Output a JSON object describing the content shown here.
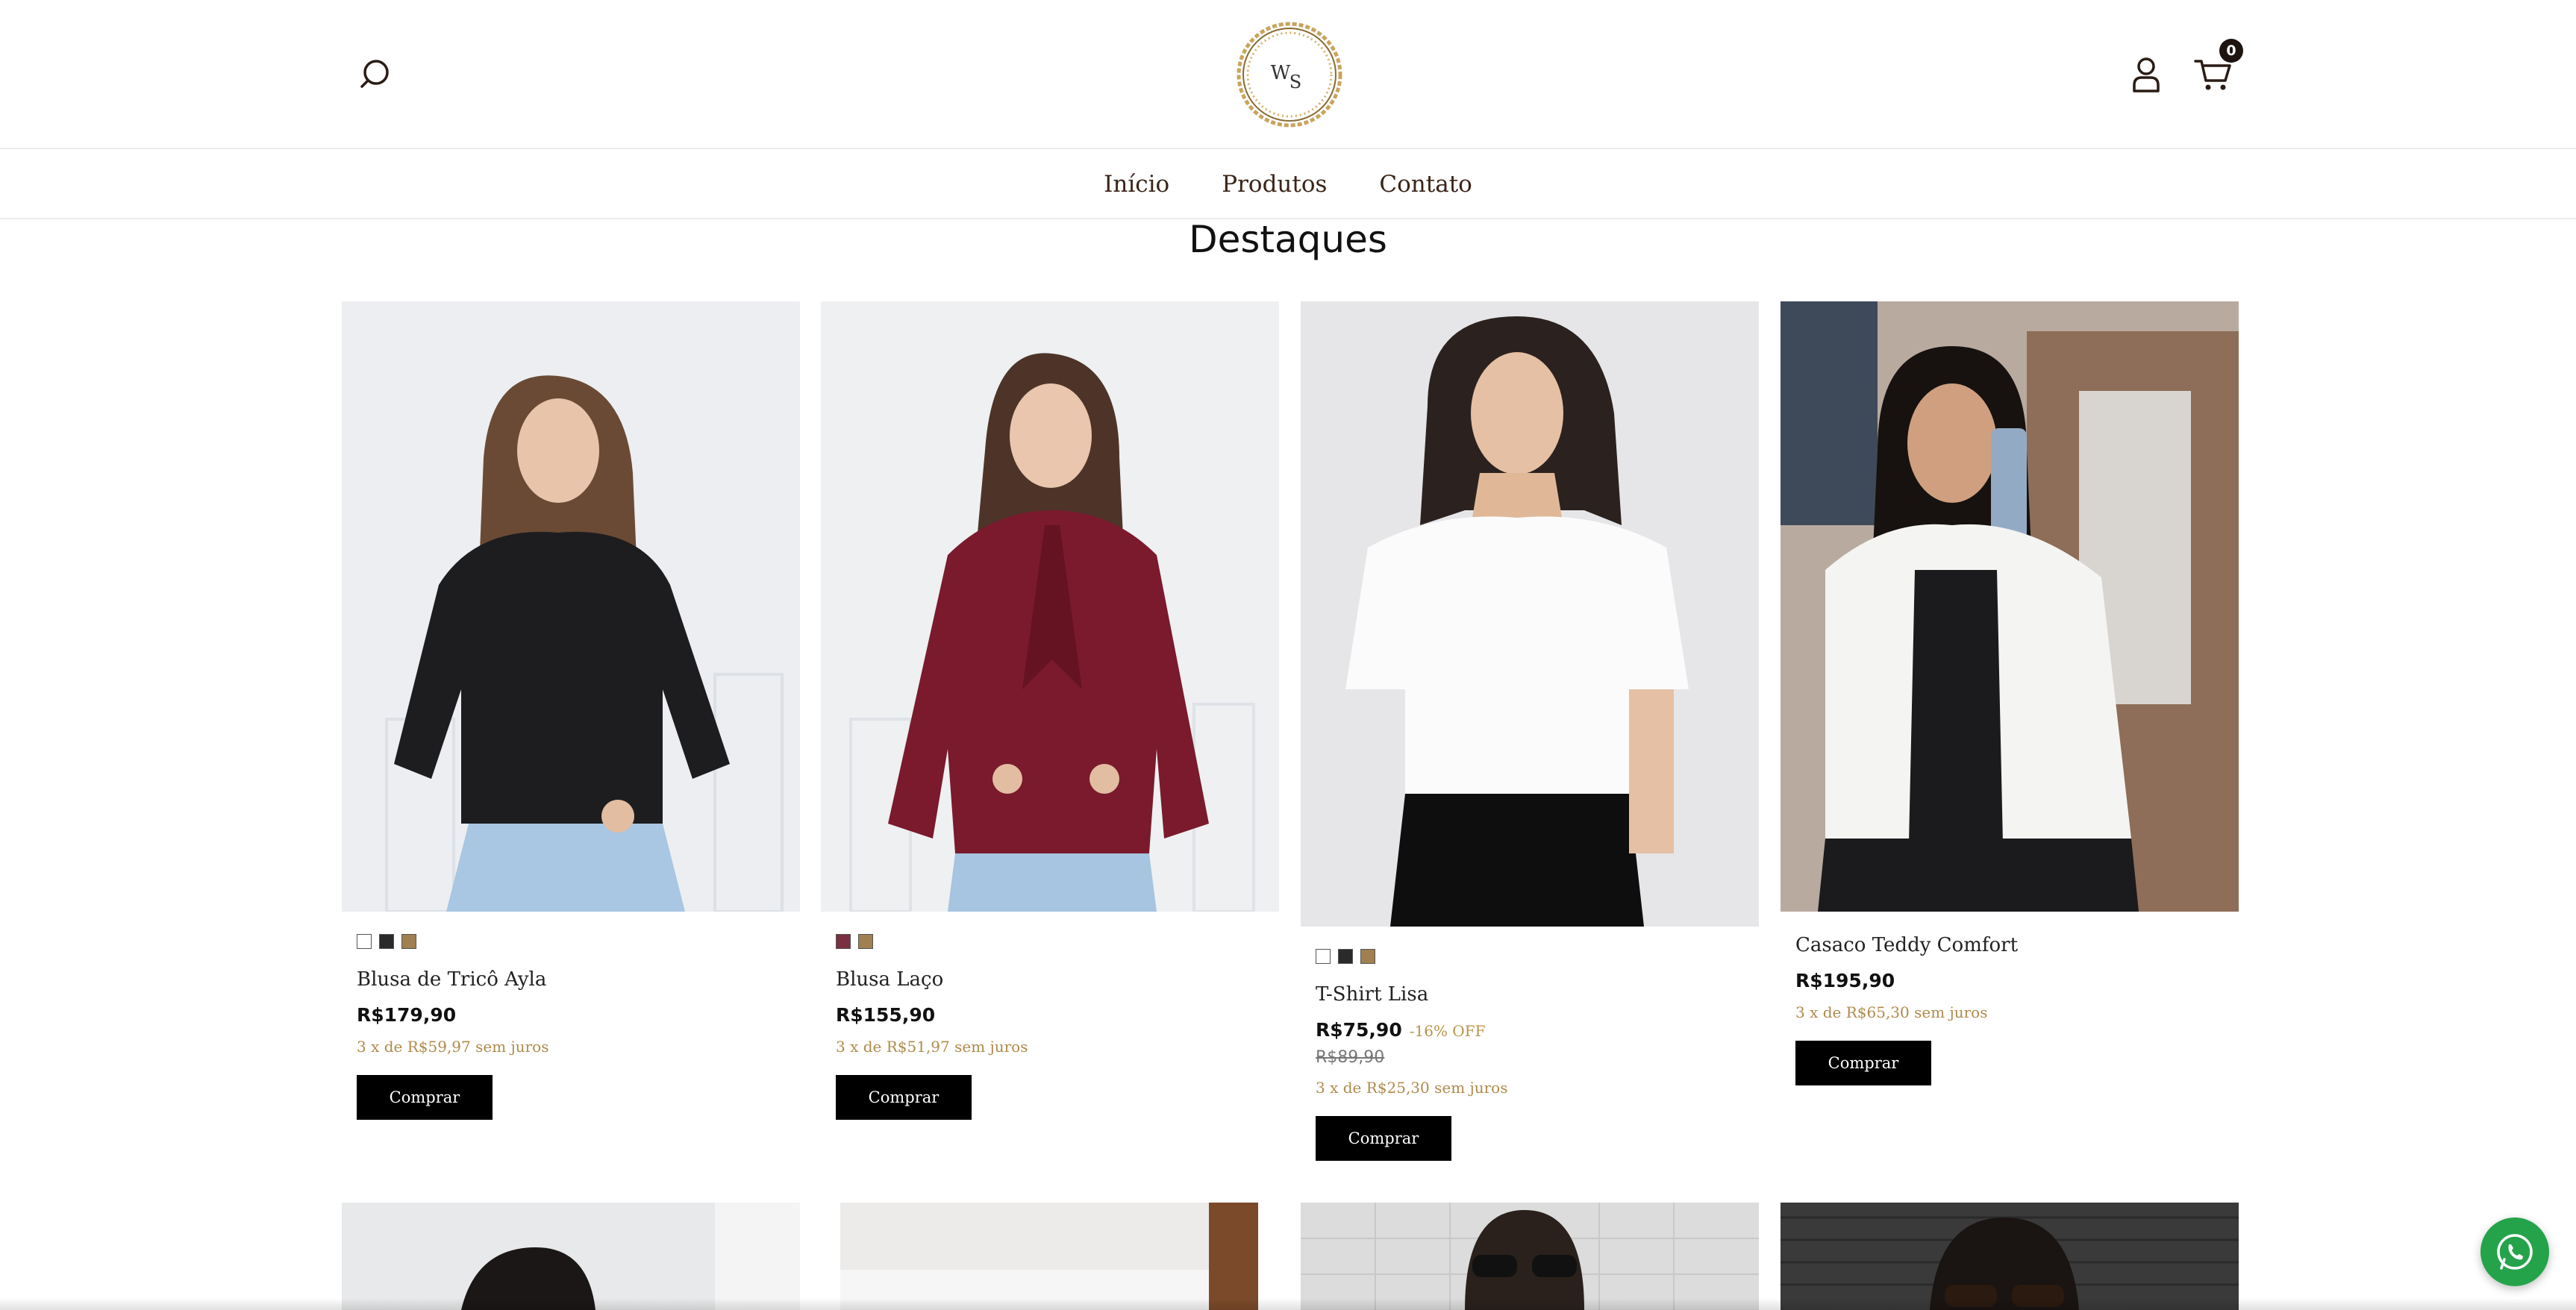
{
  "header": {
    "logo_text_1": "W",
    "logo_text_2": "S",
    "cart_count": "0"
  },
  "nav": {
    "items": [
      "Início",
      "Produtos",
      "Contato"
    ]
  },
  "section": {
    "title": "Destaques"
  },
  "products": [
    {
      "name": "Blusa de Tricô Ayla",
      "price": "R$179,90",
      "installments": "3 x de R$59,97 sem juros",
      "buy_label": "Comprar",
      "swatches": [
        "#ffffff",
        "#2a2a2a",
        "#a08050"
      ]
    },
    {
      "name": "Blusa Laço",
      "price": "R$155,90",
      "installments": "3 x de R$51,97 sem juros",
      "buy_label": "Comprar",
      "swatches": [
        "#7a3040",
        "#a08050"
      ]
    },
    {
      "name": "T-Shirt Lisa",
      "price": "R$75,90",
      "discount": "-16% OFF",
      "old_price": "R$89,90",
      "installments": "3 x de R$25,30 sem juros",
      "buy_label": "Comprar",
      "swatches": [
        "#ffffff",
        "#2a2a2a",
        "#a08050"
      ]
    },
    {
      "name": "Casaco Teddy Comfort",
      "price": "R$195,90",
      "installments": "3 x de R$65,30 sem juros",
      "buy_label": "Comprar",
      "swatches": []
    }
  ],
  "colors": {
    "accent_gold": "#b08a4a",
    "whatsapp_green": "#25a34a",
    "button_black": "#000000"
  }
}
